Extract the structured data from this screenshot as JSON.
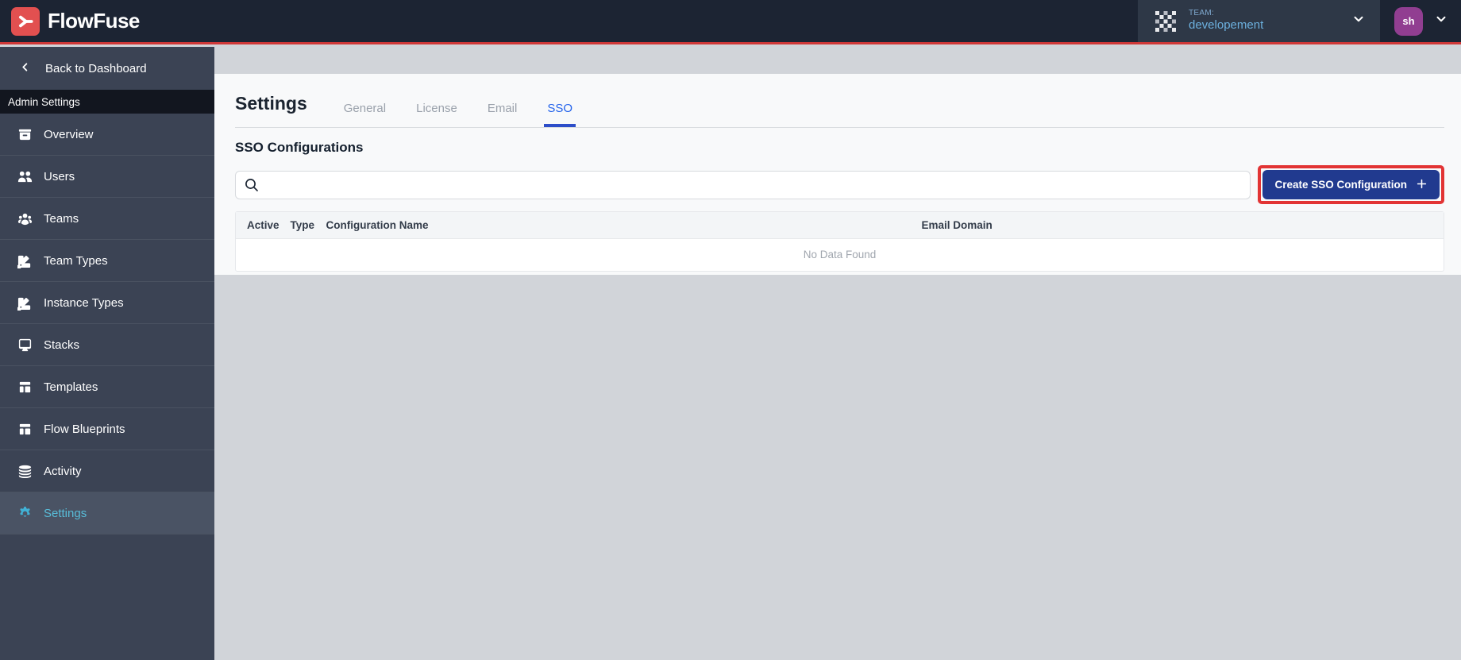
{
  "header": {
    "brand": "FlowFuse",
    "team_label": "TEAM:",
    "team_name": "developement",
    "avatar_initials": "sh"
  },
  "sidebar": {
    "back_label": "Back to Dashboard",
    "section_label": "Admin Settings",
    "items": [
      {
        "label": "Overview",
        "active": false
      },
      {
        "label": "Users",
        "active": false
      },
      {
        "label": "Teams",
        "active": false
      },
      {
        "label": "Team Types",
        "active": false
      },
      {
        "label": "Instance Types",
        "active": false
      },
      {
        "label": "Stacks",
        "active": false
      },
      {
        "label": "Templates",
        "active": false
      },
      {
        "label": "Flow Blueprints",
        "active": false
      },
      {
        "label": "Activity",
        "active": false
      },
      {
        "label": "Settings",
        "active": true
      }
    ]
  },
  "main": {
    "title": "Settings",
    "tabs": [
      {
        "label": "General",
        "active": false
      },
      {
        "label": "License",
        "active": false
      },
      {
        "label": "Email",
        "active": false
      },
      {
        "label": "SSO",
        "active": true
      }
    ],
    "section_title": "SSO Configurations",
    "search": {
      "value": "",
      "placeholder": ""
    },
    "create_button_label": "Create SSO Configuration",
    "table": {
      "columns": [
        "Active",
        "Type",
        "Configuration Name",
        "Email Domain"
      ],
      "rows": [],
      "empty_text": "No Data Found"
    }
  },
  "colors": {
    "header_bg": "#1c2433",
    "brand_red": "#e25050",
    "header_red_line": "#cf3838",
    "sidebar_bg": "#3b4354",
    "sidebar_active_text": "#58bdd9",
    "tab_active_blue": "#2463eb",
    "tab_underline_blue": "#2d4ec9",
    "button_blue": "#213a8f",
    "annotation_red": "#e23434",
    "avatar_purple": "#913e91",
    "team_name_blue": "#6cb0de"
  }
}
